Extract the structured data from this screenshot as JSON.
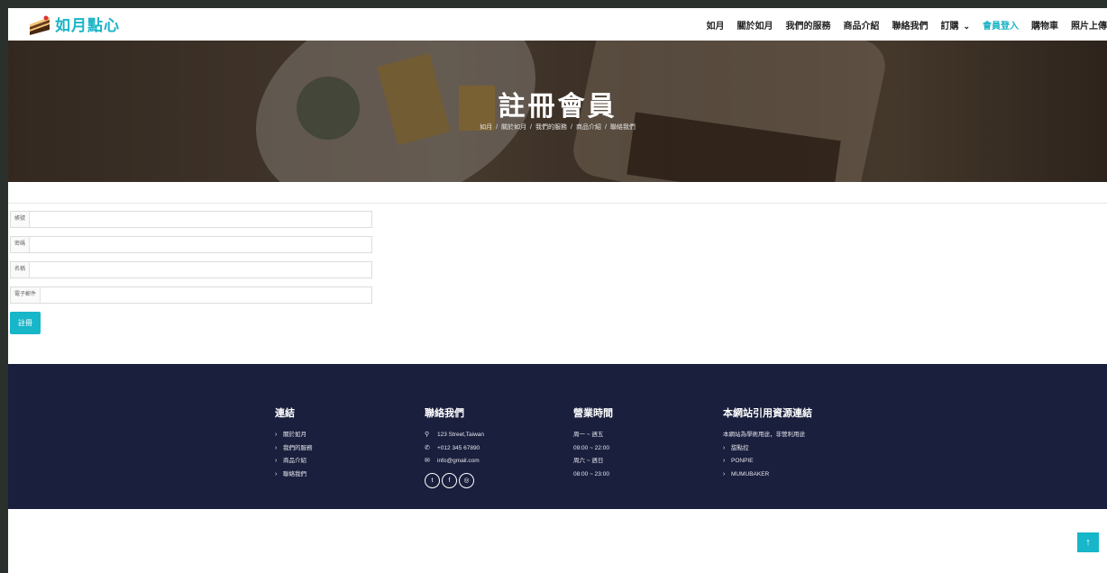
{
  "brand": {
    "name": "如月點心"
  },
  "nav": {
    "items": [
      "如月",
      "關於如月",
      "我們的服務",
      "商品介紹",
      "聯絡我們",
      "訂購",
      "會員登入",
      "購物車",
      "照片上傳"
    ]
  },
  "hero": {
    "title": "註冊會員",
    "breadcrumb": [
      "如月",
      "關於如月",
      "我們的服務",
      "商品介紹",
      "聯絡我們"
    ],
    "separator": "/"
  },
  "form": {
    "fields": [
      {
        "label": "帳號",
        "value": ""
      },
      {
        "label": "密碼",
        "value": ""
      },
      {
        "label": "名稱",
        "value": ""
      },
      {
        "label": "電子郵件",
        "value": ""
      }
    ],
    "submit_label": "註冊"
  },
  "footer": {
    "links": {
      "title": "連結",
      "items": [
        "關於如月",
        "我們的服務",
        "商品介紹",
        "聯絡我們"
      ]
    },
    "contact": {
      "title": "聯絡我們",
      "address": "123 Street,Taiwan",
      "phone": "+012 345 67890",
      "email": "info@gmail.com"
    },
    "hours": {
      "title": "營業時間",
      "lines": [
        "周一 ~ 週五",
        "09:00 ~ 22:00",
        "周六 ~ 週日",
        "08:00 ~ 23:00"
      ]
    },
    "sources": {
      "title": "本網站引用資源連結",
      "note": "本網站為學術用途，非營利用途",
      "items": [
        "甜點控",
        "PONPIE",
        "MUMUBAKER"
      ]
    }
  },
  "colors": {
    "accent": "#1ab4c6",
    "footer_bg": "#1a1f3d"
  },
  "icons": {
    "back_to_top": "arrow-up-icon",
    "social": [
      "twitter-icon",
      "facebook-icon",
      "instagram-icon"
    ]
  }
}
